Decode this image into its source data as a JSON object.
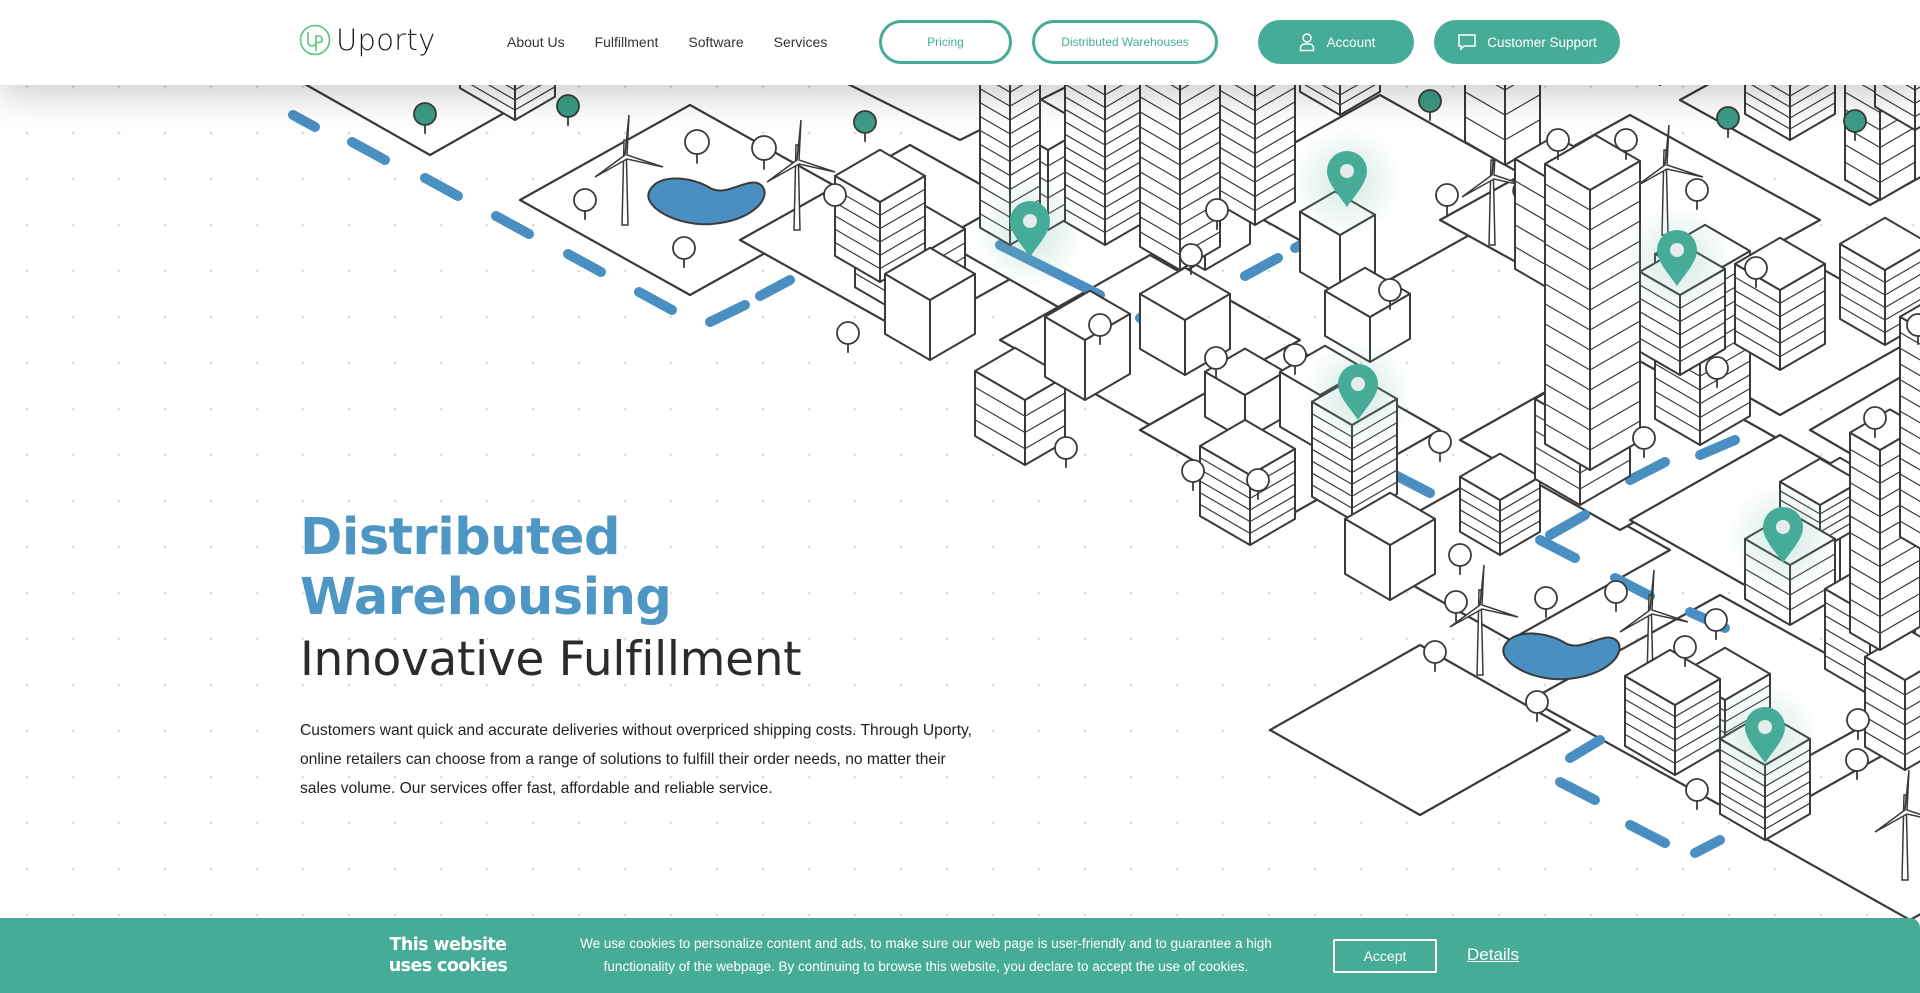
{
  "brand": {
    "name": "Uporty",
    "logo_icon": "up-monogram-icon"
  },
  "nav": {
    "links": [
      "About Us",
      "Fulfillment",
      "Software",
      "Services"
    ],
    "pricing_label": "Pricing",
    "warehouses_label": "Distributed Warehouses",
    "account_label": "Account",
    "account_icon": "user-icon",
    "support_label": "Customer Support",
    "support_icon": "chat-bubble-icon"
  },
  "hero": {
    "title": "Distributed Warehousing",
    "subtitle": "Innovative Fulfillment",
    "description": "Customers want quick and accurate deliveries without overpriced shipping costs. Through Uporty, online retailers can choose from a range of solutions to fulfill their order needs, no matter their sales volume. Our services offer fast, affordable and reliable service."
  },
  "illustration": {
    "description": "isometric city map with buildings, parks, wind turbines, ponds, delivery route and location pins",
    "icons": [
      "location-pin-icon",
      "tree-icon",
      "wind-turbine-icon",
      "pond-icon",
      "building-icon"
    ]
  },
  "cookie_bar": {
    "title": "This website uses cookies",
    "text": "We use cookies to personalize content and ads, to make sure our web page is user-friendly and to guarantee a high functionality of the webpage. By continuing to browse this website, you declare to accept the use of cookies.",
    "accept_label": "Accept",
    "details_label": "Details"
  },
  "colors": {
    "brand_green": "#47ac97",
    "title_blue": "#4e97c5",
    "route_blue": "#4a8fc2",
    "logo_green": "#5cc57e"
  }
}
